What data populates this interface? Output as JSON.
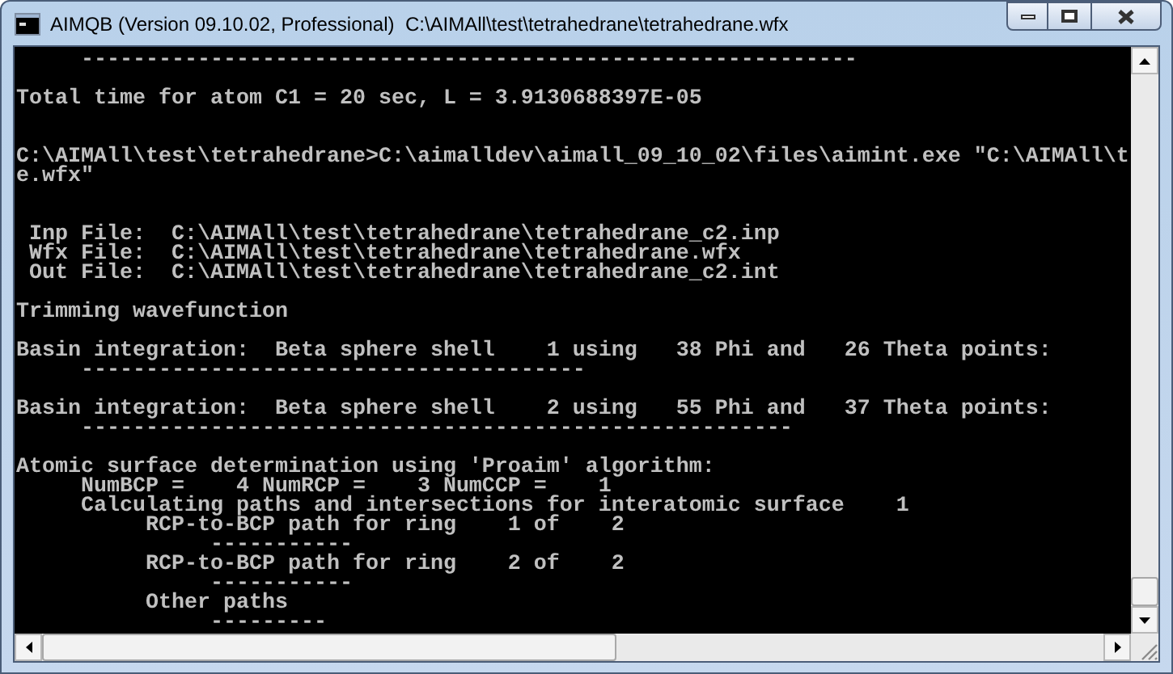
{
  "window": {
    "title": "AIMQB (Version 09.10.02, Professional)  C:\\AIMAll\\test\\tetrahedrane\\tetrahedrane.wfx"
  },
  "console": {
    "lines": [
      {
        "kind": "text",
        "text": "     ------------------------------------------------------------"
      },
      {
        "kind": "blank"
      },
      {
        "kind": "text",
        "text": "Total time for atom C1 = 20 sec, L = 3.9130688397E-05"
      },
      {
        "kind": "blank"
      },
      {
        "kind": "blank"
      },
      {
        "kind": "text",
        "text": "C:\\AIMAll\\test\\tetrahedrane>C:\\aimalldev\\aimall_09_10_02\\files\\aimint.exe \"C:\\AIMAll\\t"
      },
      {
        "kind": "text",
        "text": "e.wfx\""
      },
      {
        "kind": "blank"
      },
      {
        "kind": "blank"
      },
      {
        "kind": "text",
        "text": " Inp File:  C:\\AIMAll\\test\\tetrahedrane\\tetrahedrane_c2.inp"
      },
      {
        "kind": "text",
        "text": " Wfx File:  C:\\AIMAll\\test\\tetrahedrane\\tetrahedrane.wfx"
      },
      {
        "kind": "text",
        "text": " Out File:  C:\\AIMAll\\test\\tetrahedrane\\tetrahedrane_c2.int"
      },
      {
        "kind": "blank"
      },
      {
        "kind": "text",
        "text": "Trimming wavefunction"
      },
      {
        "kind": "blank"
      },
      {
        "kind": "text",
        "text": "Basin integration:  Beta sphere shell    1 using   38 Phi and   26 Theta points:"
      },
      {
        "kind": "text",
        "text": "     ---------------------------------------"
      },
      {
        "kind": "blank"
      },
      {
        "kind": "text",
        "text": "Basin integration:  Beta sphere shell    2 using   55 Phi and   37 Theta points:"
      },
      {
        "kind": "text",
        "text": "     -------------------------------------------------------"
      },
      {
        "kind": "blank"
      },
      {
        "kind": "text",
        "text": "Atomic surface determination using 'Proaim' algorithm:"
      },
      {
        "kind": "text",
        "text": "     NumBCP =    4 NumRCP =    3 NumCCP =    1"
      },
      {
        "kind": "text",
        "text": "     Calculating paths and intersections for interatomic surface    1"
      },
      {
        "kind": "text",
        "text": "          RCP-to-BCP path for ring    1 of    2"
      },
      {
        "kind": "text",
        "text": "               -----------"
      },
      {
        "kind": "text",
        "text": "          RCP-to-BCP path for ring    2 of    2"
      },
      {
        "kind": "text",
        "text": "               -----------"
      },
      {
        "kind": "text",
        "text": "          Other paths"
      },
      {
        "kind": "text",
        "text": "               ---------"
      }
    ]
  }
}
